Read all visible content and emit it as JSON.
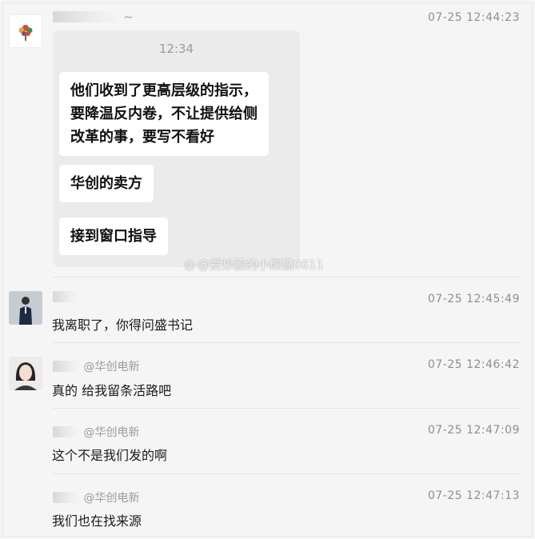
{
  "messages": [
    {
      "sender_suffix": "~",
      "time": "07-25 12:44:23",
      "screenshot": {
        "time": "12:34",
        "bubbles": [
          {
            "lines": [
              "他们收到了更高层级的指示，",
              "要降温反内卷，不让提供给侧",
              "改革的事，要写不看好"
            ]
          },
          {
            "lines": [
              "华创的卖方"
            ]
          },
          {
            "lines": [
              "接到窗口指导"
            ]
          }
        ]
      }
    },
    {
      "sender_suffix": "",
      "time": "07-25 12:45:49",
      "text": "我离职了，你得问盛书记"
    },
    {
      "sender_suffix": "@华创电新",
      "time": "07-25 12:46:42",
      "text": "真的 给我留条活路吧"
    },
    {
      "sender_suffix": "@华创电新",
      "time": "07-25 12:47:09",
      "text": "这个不是我们发的啊"
    },
    {
      "sender_suffix": "@华创电新",
      "time": "07-25 12:47:13",
      "text": "我们也在找来源"
    }
  ],
  "watermark": "@爱炒股的小熊猫0611",
  "icons": {
    "logo": "flower-logo-icon",
    "watermark": "weibo-icon"
  },
  "colors": {
    "background": "#f5f5f5",
    "bubble": "#ffffff",
    "timestamp": "#8f8f8f"
  }
}
